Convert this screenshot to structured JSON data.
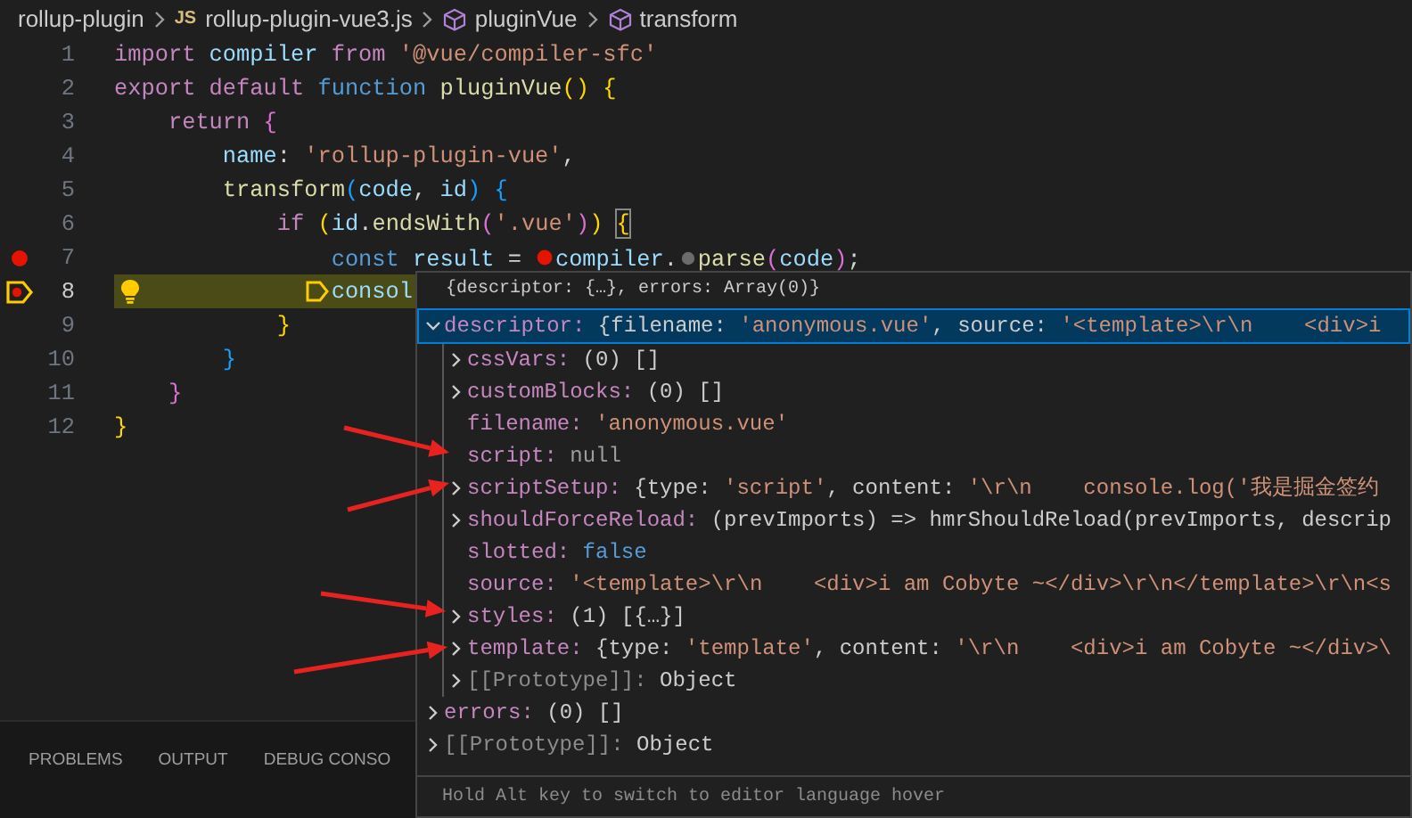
{
  "breadcrumb": [
    {
      "kind": "folder",
      "label": "rollup-plugin"
    },
    {
      "kind": "file",
      "badge": "JS",
      "label": "rollup-plugin-vue3.js"
    },
    {
      "kind": "symbol",
      "label": "pluginVue"
    },
    {
      "kind": "symbol",
      "label": "transform"
    }
  ],
  "code_lines": [
    {
      "number": "1",
      "breakpoint": false,
      "current": false,
      "lightbulb": false,
      "tokens": [
        {
          "kind": "ctrl",
          "text": "import"
        },
        {
          "kind": "var",
          "text": " compiler"
        },
        {
          "kind": "ctrl",
          "text": " from"
        },
        {
          "kind": "str",
          "text": " '@vue/compiler-sfc'"
        }
      ]
    },
    {
      "number": "2",
      "breakpoint": false,
      "current": false,
      "lightbulb": false,
      "tokens": [
        {
          "kind": "ctrl",
          "text": "export"
        },
        {
          "kind": "ctrl",
          "text": " default"
        },
        {
          "kind": "kw",
          "text": " function"
        },
        {
          "kind": "fn",
          "text": " pluginVue"
        },
        {
          "kind": "b1",
          "text": "()"
        },
        {
          "kind": "b1",
          "text": " {"
        }
      ]
    },
    {
      "number": "3",
      "breakpoint": false,
      "current": false,
      "lightbulb": false,
      "tokens": [
        {
          "kind": "ctrl",
          "text": "    return"
        },
        {
          "kind": "b2",
          "text": " {"
        }
      ]
    },
    {
      "number": "4",
      "breakpoint": false,
      "current": false,
      "lightbulb": false,
      "tokens": [
        {
          "kind": "var",
          "text": "        name"
        },
        {
          "kind": "plain",
          "text": ": "
        },
        {
          "kind": "str",
          "text": "'rollup-plugin-vue'"
        },
        {
          "kind": "plain",
          "text": ","
        }
      ]
    },
    {
      "number": "5",
      "breakpoint": false,
      "current": false,
      "lightbulb": false,
      "tokens": [
        {
          "kind": "fn",
          "text": "        transform"
        },
        {
          "kind": "b3",
          "text": "("
        },
        {
          "kind": "var",
          "text": "code"
        },
        {
          "kind": "plain",
          "text": ", "
        },
        {
          "kind": "var",
          "text": "id"
        },
        {
          "kind": "b3",
          "text": ")"
        },
        {
          "kind": "b3",
          "text": " {"
        }
      ]
    },
    {
      "number": "6",
      "breakpoint": false,
      "current": false,
      "lightbulb": false,
      "tokens": [
        {
          "kind": "ctrl",
          "text": "            if"
        },
        {
          "kind": "b1",
          "text": " ("
        },
        {
          "kind": "var",
          "text": "id"
        },
        {
          "kind": "plain",
          "text": "."
        },
        {
          "kind": "fn",
          "text": "endsWith"
        },
        {
          "kind": "b2",
          "text": "("
        },
        {
          "kind": "str",
          "text": "'.vue'"
        },
        {
          "kind": "b2",
          "text": ")"
        },
        {
          "kind": "b1",
          "text": ") "
        },
        {
          "kind": "match",
          "text": "{"
        }
      ]
    },
    {
      "number": "7",
      "breakpoint": true,
      "current": false,
      "lightbulb": false,
      "tokens": [
        {
          "kind": "kw",
          "text": "                const"
        },
        {
          "kind": "var",
          "text": " result"
        },
        {
          "kind": "plain",
          "text": " = "
        },
        {
          "kind": "inline_breakpoint"
        },
        {
          "kind": "var",
          "text": "compiler"
        },
        {
          "kind": "plain",
          "text": "."
        },
        {
          "kind": "inline_stop"
        },
        {
          "kind": "fn",
          "text": "parse"
        },
        {
          "kind": "b2",
          "text": "("
        },
        {
          "kind": "var",
          "text": "code"
        },
        {
          "kind": "b2",
          "text": ")"
        },
        {
          "kind": "plain",
          "text": ";"
        }
      ]
    },
    {
      "number": "8",
      "breakpoint": true,
      "current": true,
      "lightbulb": true,
      "tokens": [
        {
          "kind": "var",
          "text": "                consol"
        }
      ]
    },
    {
      "number": "9",
      "breakpoint": false,
      "current": false,
      "lightbulb": false,
      "tokens": [
        {
          "kind": "b1",
          "text": "            }"
        }
      ]
    },
    {
      "number": "10",
      "breakpoint": false,
      "current": false,
      "lightbulb": false,
      "tokens": [
        {
          "kind": "b3",
          "text": "        }"
        }
      ]
    },
    {
      "number": "11",
      "breakpoint": false,
      "current": false,
      "lightbulb": false,
      "tokens": [
        {
          "kind": "b2",
          "text": "    }"
        }
      ]
    },
    {
      "number": "12",
      "breakpoint": false,
      "current": false,
      "lightbulb": false,
      "tokens": [
        {
          "kind": "b1",
          "text": "}"
        }
      ]
    }
  ],
  "panel_tabs": [
    {
      "label": "PROBLEMS"
    },
    {
      "label": "OUTPUT"
    },
    {
      "label": "DEBUG CONSO"
    }
  ],
  "hover": {
    "summary": "{descriptor: {…}, errors: Array(0)}",
    "tree": [
      {
        "kind": "node",
        "label": "descriptor:",
        "expanded": true,
        "selected": true,
        "value": [
          {
            "kind": "plain",
            "text": " {filename: "
          },
          {
            "kind": "str",
            "text": "'anonymous.vue'"
          },
          {
            "kind": "plain",
            "text": ", source: "
          },
          {
            "kind": "str",
            "text": "'<template>\\r\\n    <div>i"
          }
        ],
        "children": [
          {
            "kind": "node",
            "label": "cssVars:",
            "expanded": false,
            "selected": false,
            "value": [
              {
                "kind": "plain",
                "text": " (0) []"
              }
            ]
          },
          {
            "kind": "node",
            "label": "customBlocks:",
            "expanded": false,
            "selected": false,
            "value": [
              {
                "kind": "plain",
                "text": " (0) []"
              }
            ]
          },
          {
            "kind": "leaf",
            "label": "filename:",
            "selected": false,
            "value": [
              {
                "kind": "str",
                "text": " 'anonymous.vue'"
              }
            ]
          },
          {
            "kind": "leaf",
            "label": "script:",
            "selected": false,
            "value": [
              {
                "kind": "null",
                "text": " null"
              }
            ]
          },
          {
            "kind": "node",
            "label": "scriptSetup:",
            "expanded": false,
            "selected": false,
            "value": [
              {
                "kind": "plain",
                "text": " {type: "
              },
              {
                "kind": "str",
                "text": "'script'"
              },
              {
                "kind": "plain",
                "text": ", content: "
              },
              {
                "kind": "str",
                "text": "'\\r\\n    console.log('我是掘金签约"
              }
            ]
          },
          {
            "kind": "node",
            "label": "shouldForceReload:",
            "expanded": false,
            "selected": false,
            "value": [
              {
                "kind": "plain",
                "text": " (prevImports) => hmrShouldReload(prevImports, descrip"
              }
            ]
          },
          {
            "kind": "leaf",
            "label": "slotted:",
            "selected": false,
            "value": [
              {
                "kind": "bool",
                "text": " false"
              }
            ]
          },
          {
            "kind": "leaf",
            "label": "source:",
            "selected": false,
            "value": [
              {
                "kind": "str",
                "text": " '<template>\\r\\n    <div>i am Cobyte ~</div>\\r\\n</template>\\r\\n<s"
              }
            ]
          },
          {
            "kind": "node",
            "label": "styles:",
            "expanded": false,
            "selected": false,
            "value": [
              {
                "kind": "plain",
                "text": " (1) [{…}]"
              }
            ]
          },
          {
            "kind": "node",
            "label": "template:",
            "expanded": false,
            "selected": false,
            "value": [
              {
                "kind": "plain",
                "text": " {type: "
              },
              {
                "kind": "str",
                "text": "'template'"
              },
              {
                "kind": "plain",
                "text": ", content: "
              },
              {
                "kind": "str",
                "text": "'\\r\\n    <div>i am Cobyte ~</div>\\"
              }
            ]
          },
          {
            "kind": "internal",
            "label": "[[Prototype]]:",
            "expanded": false,
            "selected": false,
            "value": [
              {
                "kind": "plain",
                "text": " Object"
              }
            ]
          }
        ]
      },
      {
        "kind": "node",
        "label": "errors:",
        "expanded": false,
        "selected": false,
        "value": [
          {
            "kind": "plain",
            "text": " (0) []"
          }
        ]
      },
      {
        "kind": "internal",
        "label": "[[Prototype]]:",
        "expanded": false,
        "selected": false,
        "value": [
          {
            "kind": "plain",
            "text": " Object"
          }
        ]
      }
    ],
    "footer": "Hold Alt key to switch to editor language hover"
  }
}
